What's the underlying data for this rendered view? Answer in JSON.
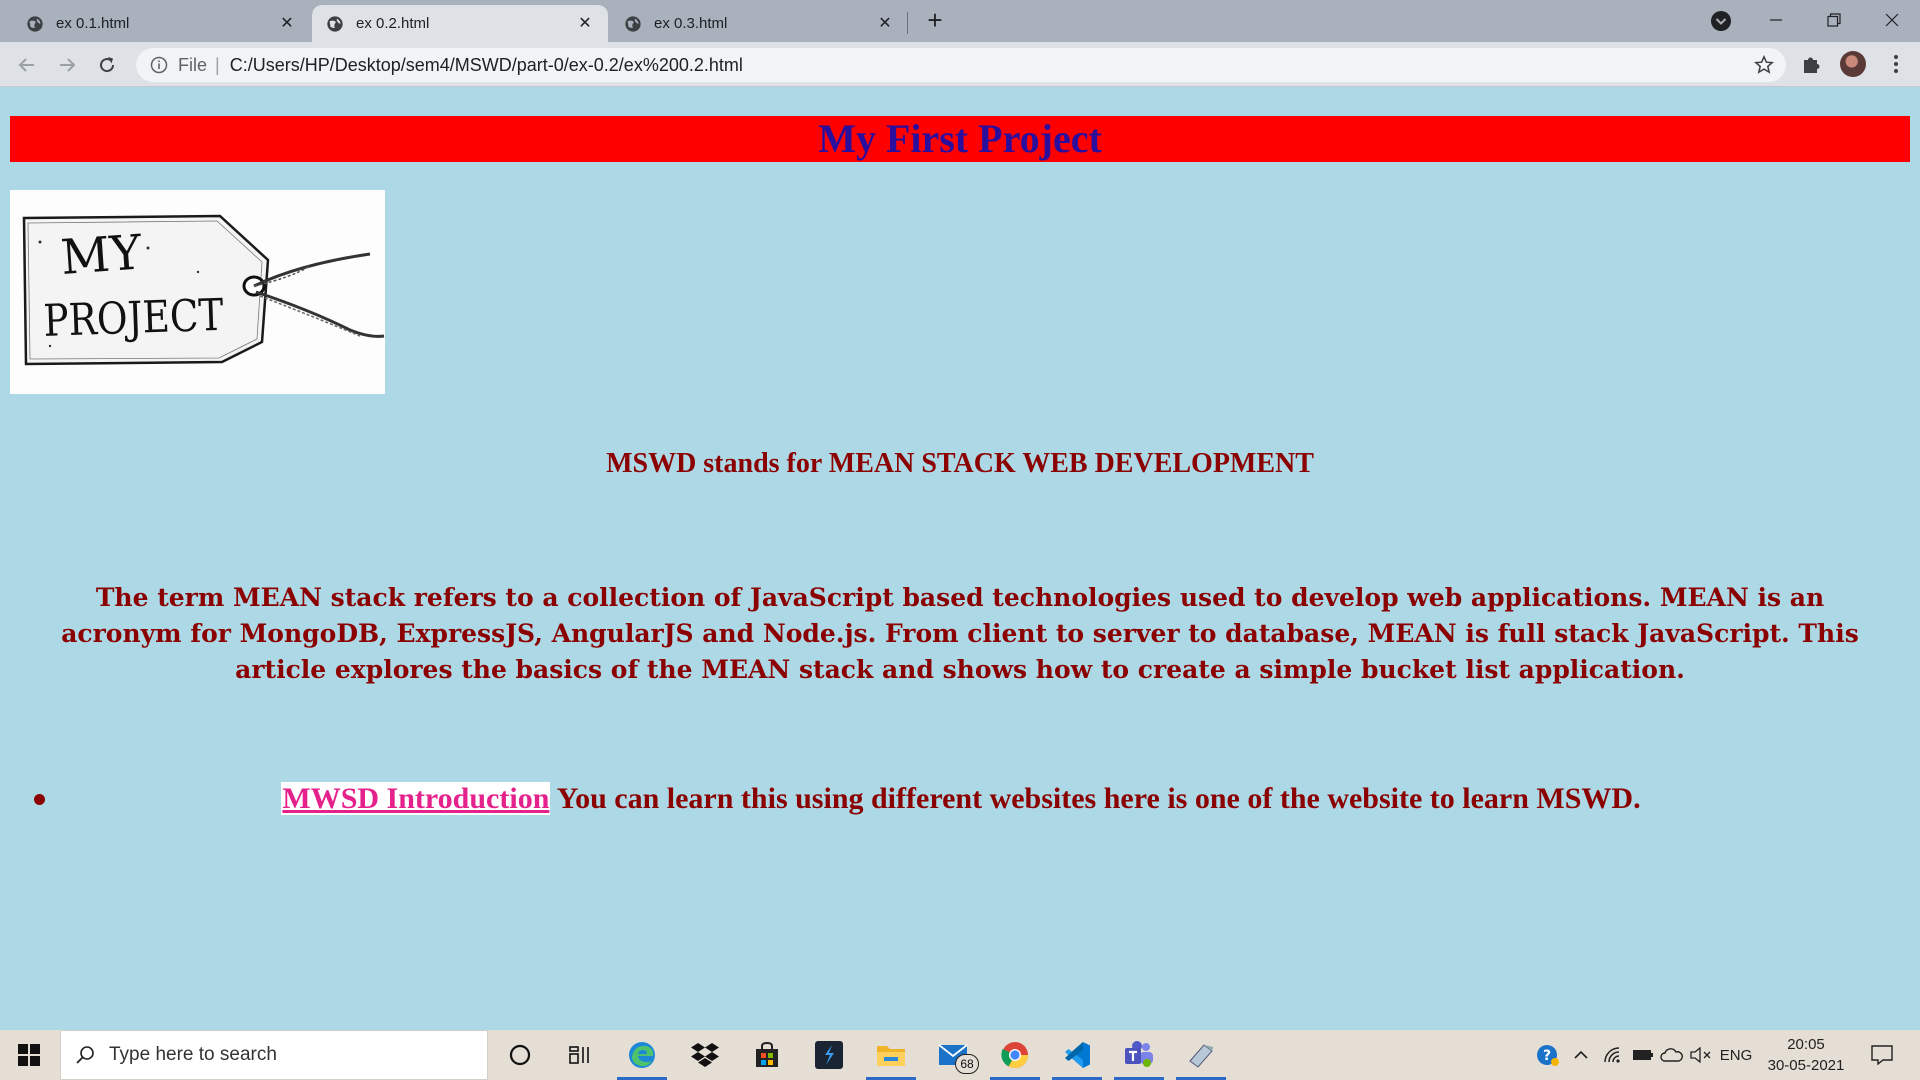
{
  "browser": {
    "tabs": [
      {
        "title": "ex 0.1.html",
        "active": false
      },
      {
        "title": "ex 0.2.html",
        "active": true
      },
      {
        "title": "ex 0.3.html",
        "active": false
      }
    ],
    "address": {
      "scheme_label": "File",
      "url": "C:/Users/HP/Desktop/sem4/MSWD/part-0/ex-0.2/ex%200.2.html"
    },
    "colors": {
      "tabbar": "#a9b1bd",
      "toolbar": "#dee1e6",
      "omnibox": "#f1f3f4"
    }
  },
  "page": {
    "background": "#add8e6",
    "banner": {
      "title": "My First Project",
      "background": "#ff0000",
      "text_color": "#2a0f9e"
    },
    "image": {
      "alt_text": "MY PROJECT",
      "line1": "MY",
      "line2": "PROJECT"
    },
    "subtitle": "MSWD stands for MEAN STACK WEB DEVELOPMENT",
    "description": "The term MEAN stack refers to a collection of JavaScript based technologies used to develop web applications. MEAN is an acronym for MongoDB, ExpressJS, AngularJS and Node.js. From client to server to database, MEAN is full stack JavaScript. This article explores the basics of the MEAN stack and shows how to create a simple bucket list application.",
    "list": [
      {
        "link_text": "MWSD Introduction",
        "text": " You can learn this using different websites here is one of the website to learn MSWD."
      }
    ],
    "text_color": "#8b0000",
    "link_color": "#e5218c"
  },
  "taskbar": {
    "search_placeholder": "Type here to search",
    "mail_badge": "68",
    "language": "ENG",
    "time": "20:05",
    "date": "30-05-2021",
    "apps": [
      "cortana-icon",
      "task-view-icon",
      "edge-icon",
      "dropbox-icon",
      "store-icon",
      "visual-studio-icon",
      "file-explorer-icon",
      "mail-icon",
      "chrome-icon",
      "vscode-icon",
      "teams-icon",
      "paint-icon"
    ]
  }
}
